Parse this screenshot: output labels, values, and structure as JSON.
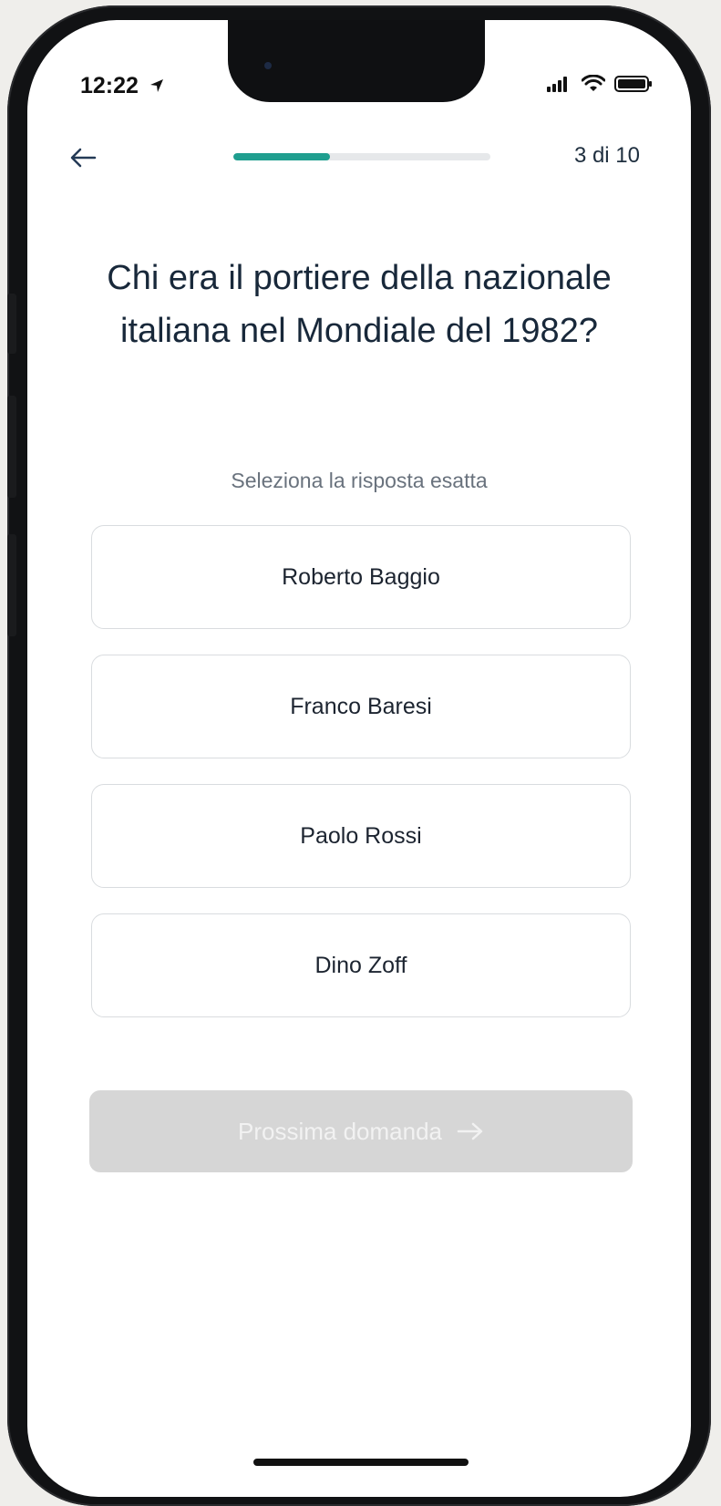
{
  "status_bar": {
    "time": "12:22",
    "location_icon": "location-arrow-icon",
    "signal_icon": "cellular-signal-icon",
    "wifi_icon": "wifi-icon",
    "battery_icon": "battery-icon"
  },
  "header": {
    "back_icon": "arrow-left-icon",
    "progress": {
      "current": 3,
      "total": 10,
      "fraction": 0.375,
      "color": "#1f9e8f"
    },
    "progress_label": "3 di 10"
  },
  "quiz": {
    "question": "Chi era il portiere della nazionale italiana nel Mondiale del 1982?",
    "instruction": "Seleziona la risposta esatta",
    "answers": [
      {
        "label": "Roberto Baggio"
      },
      {
        "label": "Franco Baresi"
      },
      {
        "label": "Paolo Rossi"
      },
      {
        "label": "Dino Zoff"
      }
    ]
  },
  "footer": {
    "next_label": "Prossima domanda",
    "next_icon": "arrow-right-icon",
    "next_disabled_bg": "#d6d6d6"
  }
}
